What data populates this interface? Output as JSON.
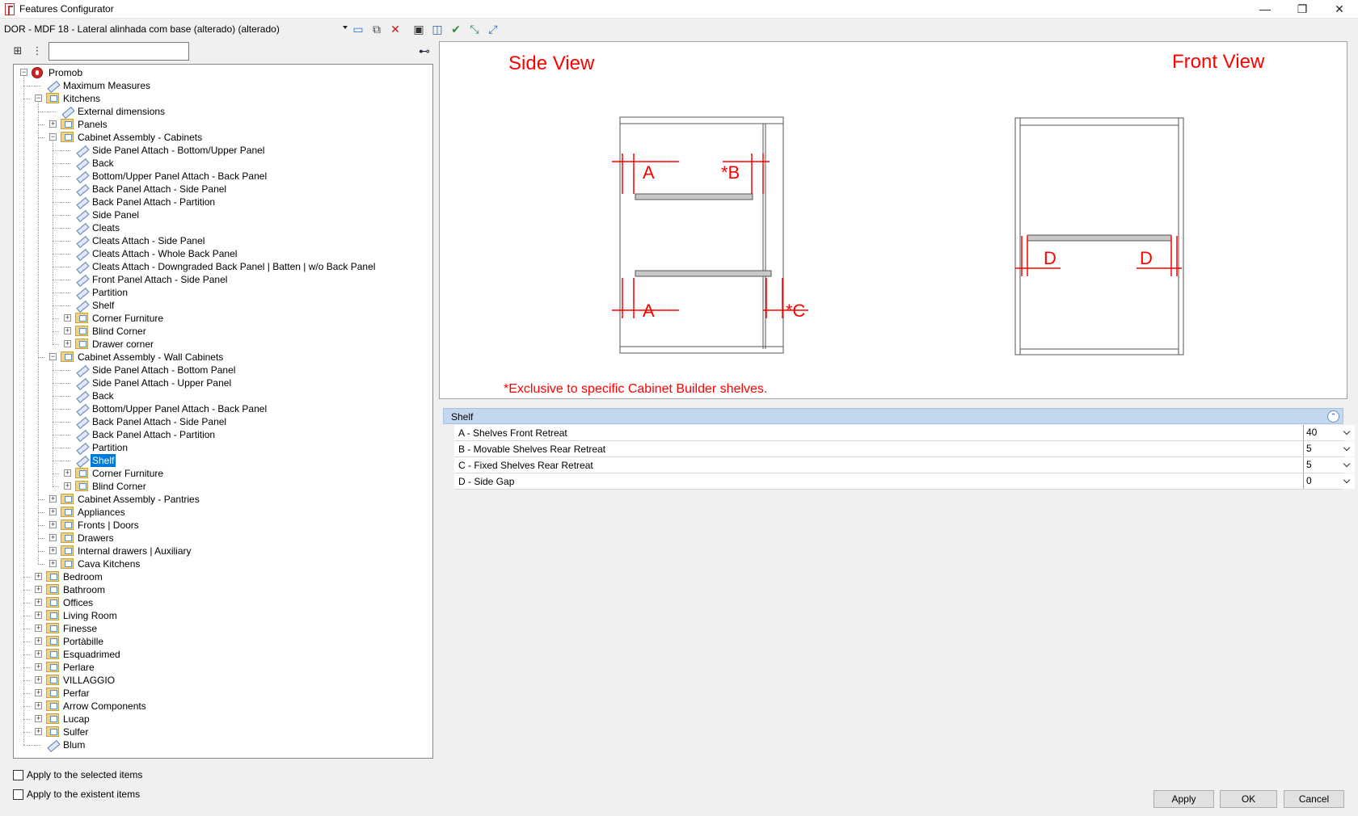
{
  "window": {
    "title": "Features Configurator",
    "minimize": "—",
    "maximize": "❐",
    "close": "✕"
  },
  "toolbar": {
    "document": "DOR - MDF 18 - Lateral alinhada com base (alterado) (alterado)"
  },
  "tree": {
    "search_value": "",
    "nodes": [
      {
        "label": "Promob",
        "level": 0,
        "type": "root",
        "expand": "-"
      },
      {
        "label": "Maximum Measures",
        "level": 1,
        "type": "feat"
      },
      {
        "label": "Kitchens",
        "level": 1,
        "type": "folder",
        "expand": "-"
      },
      {
        "label": "External dimensions",
        "level": 2,
        "type": "feat"
      },
      {
        "label": "Panels",
        "level": 2,
        "type": "folder",
        "expand": "+"
      },
      {
        "label": "Cabinet Assembly - Cabinets",
        "level": 2,
        "type": "folder",
        "expand": "-"
      },
      {
        "label": "Side Panel Attach - Bottom/Upper Panel",
        "level": 3,
        "type": "feat"
      },
      {
        "label": " Back",
        "level": 3,
        "type": "feat"
      },
      {
        "label": " Bottom/Upper Panel Attach - Back Panel",
        "level": 3,
        "type": "feat"
      },
      {
        "label": "Back Panel Attach - Side Panel",
        "level": 3,
        "type": "feat"
      },
      {
        "label": "Back Panel Attach - Partition",
        "level": 3,
        "type": "feat"
      },
      {
        "label": "Side Panel",
        "level": 3,
        "type": "feat"
      },
      {
        "label": "Cleats",
        "level": 3,
        "type": "feat"
      },
      {
        "label": "Cleats Attach - Side Panel",
        "level": 3,
        "type": "feat"
      },
      {
        "label": "Cleats Attach - Whole Back Panel",
        "level": 3,
        "type": "feat"
      },
      {
        "label": "Cleats Attach - Downgraded Back Panel | Batten | w/o Back Panel",
        "level": 3,
        "type": "feat"
      },
      {
        "label": "Front Panel Attach - Side Panel",
        "level": 3,
        "type": "feat"
      },
      {
        "label": "Partition",
        "level": 3,
        "type": "feat"
      },
      {
        "label": "Shelf",
        "level": 3,
        "type": "feat"
      },
      {
        "label": "Corner Furniture",
        "level": 3,
        "type": "folder",
        "expand": "+"
      },
      {
        "label": "Blind Corner",
        "level": 3,
        "type": "folder",
        "expand": "+"
      },
      {
        "label": "Drawer corner",
        "level": 3,
        "type": "folder",
        "expand": "+"
      },
      {
        "label": "Cabinet Assembly - Wall Cabinets",
        "level": 2,
        "type": "folder",
        "expand": "-"
      },
      {
        "label": "Side Panel Attach - Bottom Panel",
        "level": 3,
        "type": "feat"
      },
      {
        "label": " Side Panel Attach - Upper Panel",
        "level": 3,
        "type": "feat"
      },
      {
        "label": " Back",
        "level": 3,
        "type": "feat"
      },
      {
        "label": " Bottom/Upper Panel Attach - Back Panel",
        "level": 3,
        "type": "feat"
      },
      {
        "label": "Back Panel Attach - Side Panel",
        "level": 3,
        "type": "feat"
      },
      {
        "label": "Back Panel Attach - Partition",
        "level": 3,
        "type": "feat"
      },
      {
        "label": "Partition",
        "level": 3,
        "type": "feat"
      },
      {
        "label": "Shelf",
        "level": 3,
        "type": "feat",
        "selected": true
      },
      {
        "label": "Corner Furniture",
        "level": 3,
        "type": "folder",
        "expand": "+"
      },
      {
        "label": "Blind Corner",
        "level": 3,
        "type": "folder",
        "expand": "+"
      },
      {
        "label": "Cabinet Assembly - Pantries",
        "level": 2,
        "type": "folder",
        "expand": "+"
      },
      {
        "label": "Appliances",
        "level": 2,
        "type": "folder",
        "expand": "+"
      },
      {
        "label": "Fronts | Doors",
        "level": 2,
        "type": "folder",
        "expand": "+"
      },
      {
        "label": "Drawers",
        "level": 2,
        "type": "folder",
        "expand": "+"
      },
      {
        "label": "Internal drawers | Auxiliary",
        "level": 2,
        "type": "folder",
        "expand": "+"
      },
      {
        "label": "Cava Kitchens",
        "level": 2,
        "type": "folder",
        "expand": "+"
      },
      {
        "label": "Bedroom",
        "level": 1,
        "type": "folder",
        "expand": "+"
      },
      {
        "label": "Bathroom",
        "level": 1,
        "type": "folder",
        "expand": "+"
      },
      {
        "label": "Offices",
        "level": 1,
        "type": "folder",
        "expand": "+"
      },
      {
        "label": "Living Room",
        "level": 1,
        "type": "folder",
        "expand": "+"
      },
      {
        "label": "Finesse",
        "level": 1,
        "type": "folder",
        "expand": "+"
      },
      {
        "label": "Portàbille",
        "level": 1,
        "type": "folder",
        "expand": "+"
      },
      {
        "label": "Esquadrimed",
        "level": 1,
        "type": "folder",
        "expand": "+"
      },
      {
        "label": "Perlare",
        "level": 1,
        "type": "folder",
        "expand": "+"
      },
      {
        "label": "VILLAGGIO",
        "level": 1,
        "type": "folder",
        "expand": "+"
      },
      {
        "label": "Perfar",
        "level": 1,
        "type": "folder",
        "expand": "+"
      },
      {
        "label": "Arrow Components",
        "level": 1,
        "type": "folder",
        "expand": "+"
      },
      {
        "label": "Lucap",
        "level": 1,
        "type": "folder",
        "expand": "+"
      },
      {
        "label": "Sulfer",
        "level": 1,
        "type": "folder",
        "expand": "+"
      },
      {
        "label": "Blum",
        "level": 1,
        "type": "feat"
      }
    ]
  },
  "options": {
    "apply_selected": "Apply to the selected items",
    "apply_existent": "Apply to the existent items"
  },
  "preview": {
    "side_view_title": "Side View",
    "front_view_title": "Front View",
    "label_a": "A",
    "label_b": "*B",
    "label_c": "*C",
    "label_d": "D",
    "note": "*Exclusive to specific Cabinet Builder shelves.",
    "accent_color": "#ff0000"
  },
  "properties": {
    "group_title": "Shelf",
    "rows": [
      {
        "label": "A - Shelves Front Retreat",
        "value": "40"
      },
      {
        "label": "B - Movable Shelves Rear Retreat",
        "value": "5"
      },
      {
        "label": "C - Fixed Shelves Rear Retreat",
        "value": "5"
      },
      {
        "label": "D - Side Gap",
        "value": "0"
      }
    ]
  },
  "buttons": {
    "apply": "Apply",
    "ok": "OK",
    "cancel": "Cancel"
  }
}
